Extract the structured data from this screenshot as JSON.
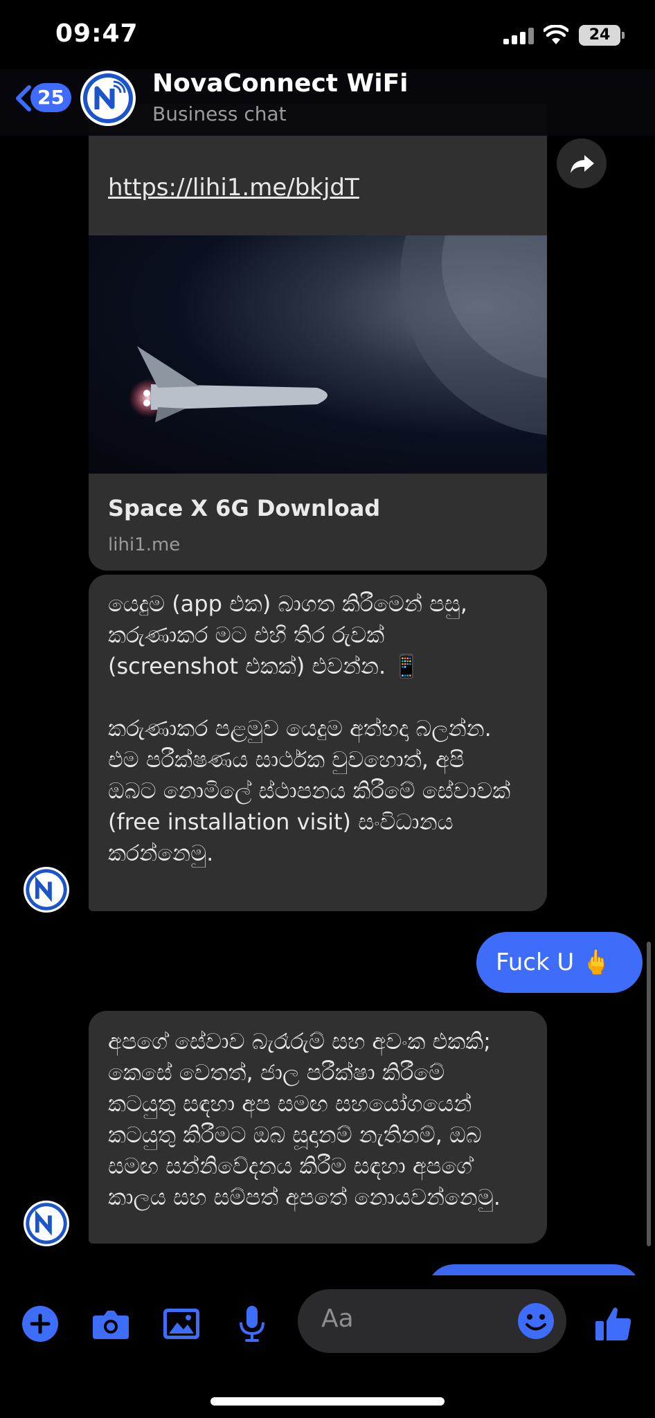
{
  "status": {
    "time": "09:47",
    "battery": "24"
  },
  "header": {
    "back_count": "25",
    "title": "NovaConnect WiFi",
    "subtitle": "Business chat"
  },
  "messages": {
    "m1_link": "https://lihi1.me/bkjdT",
    "m1_card_title": "Space X 6G Download",
    "m1_card_domain": "lihi1.me",
    "m2_text": "යෙදුම (app එක) බාගත කිරීමෙන් පසු,\nකරුණාකර මට එහි තිර රුවක්\n(screenshot එකක්) එවන්න. 📱\n\nකරුණාකර පළමුව යෙදුම අත්හදා බලන්න.\nඑම පරීක්ෂණය සාර්ථක වුවහොත්, අපි\nඔබට නොමිලේ ස්ථාපනය කිරීමේ සේවාවක්\n(free installation visit) සංවිධානය\nකරන්නෙමු.",
    "m3_text": "Fuck U 🖕",
    "m4_text": "අපගේ සේවාව බැරෑරුම් සහ අවංක එකකි;\nකෙසේ වෙතත්, ජාල පරීක්ෂා කිරීමේ\nකටයුතු සඳහා අප සමඟ සහයෝගයෙන්\nකටයුතු කිරීමට ඔබ සූදානම් නැතිනම්, ඔබ\nසමඟ සන්නිවේදනය කිරීම සඳහා අපගේ\nකාලය සහ සම්පත් අපතේ නොයවන්නෙමු."
  },
  "composer": {
    "placeholder": "Aa"
  },
  "colors": {
    "accent": "#3d6dfa",
    "bubble_incoming": "#303030",
    "background": "#000000"
  }
}
